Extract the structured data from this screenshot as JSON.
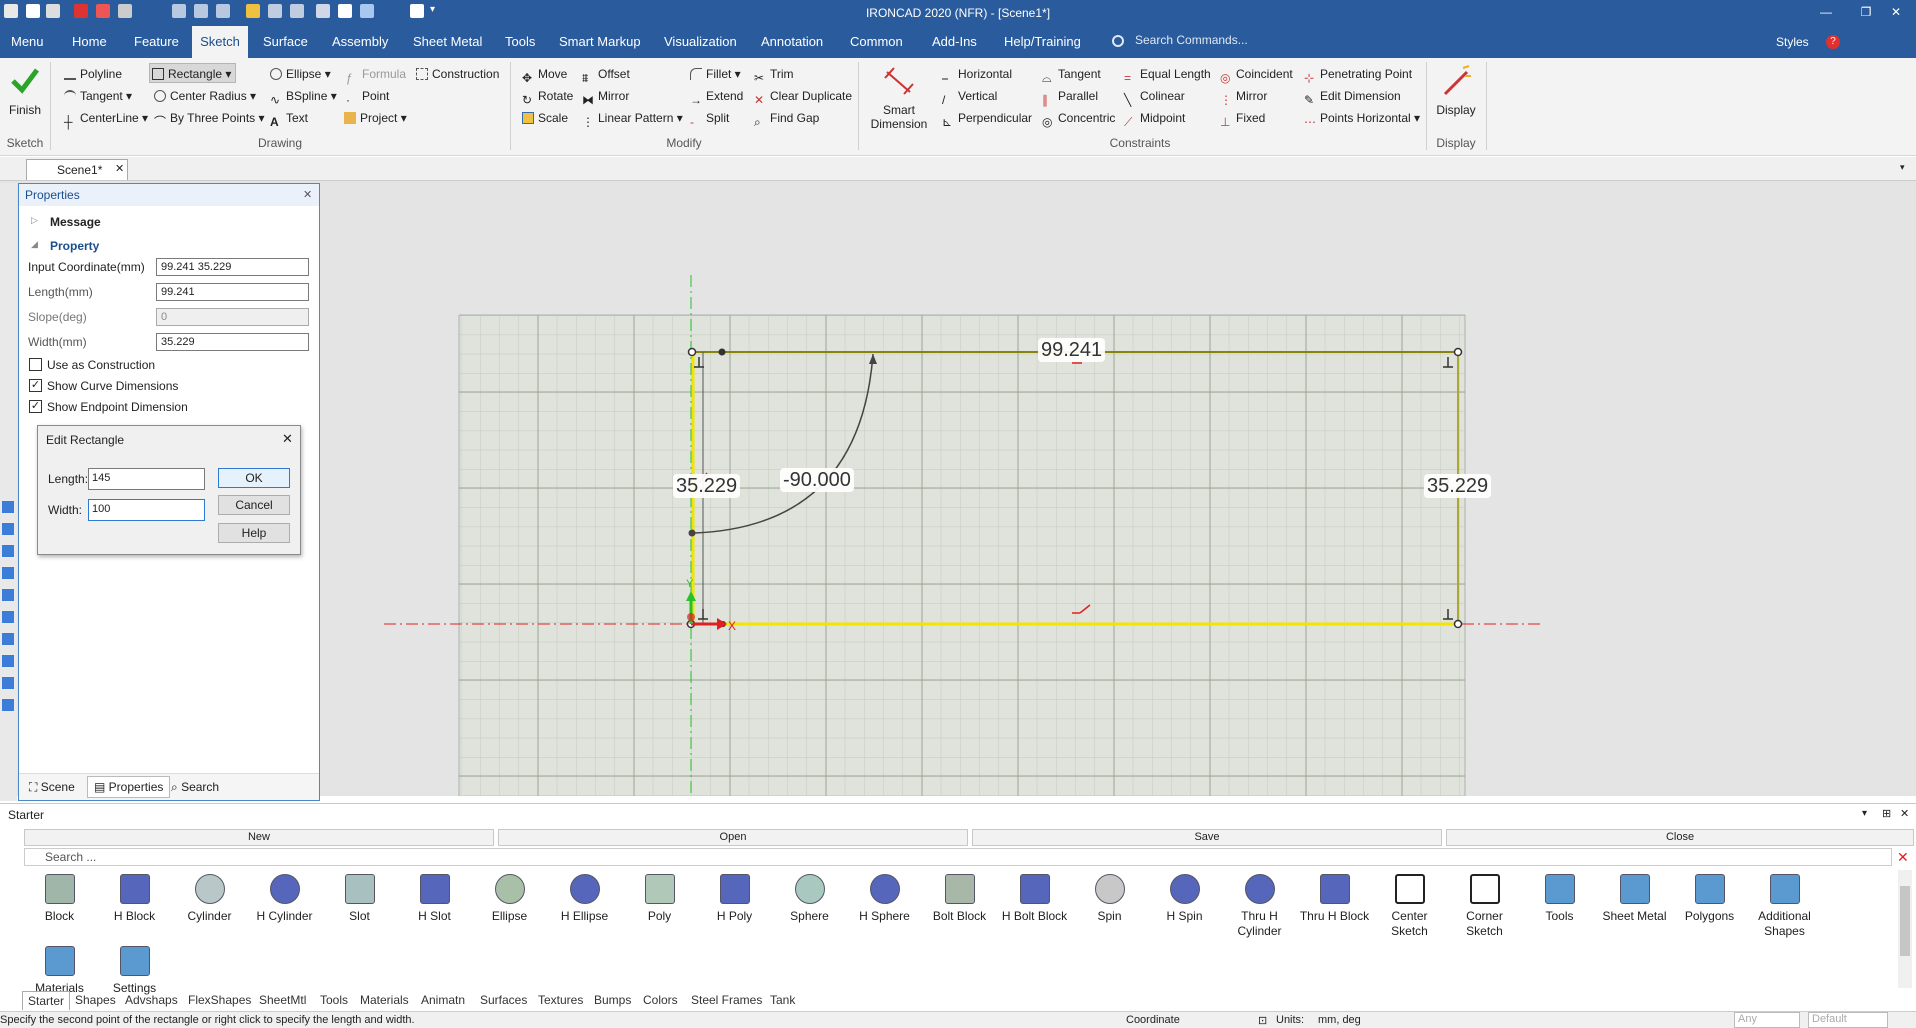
{
  "window": {
    "title": "IRONCAD 2020 (NFR) - [Scene1*]"
  },
  "menu": {
    "items": [
      "Menu",
      "Home",
      "Feature",
      "Sketch",
      "Surface",
      "Assembly",
      "Sheet Metal",
      "Tools",
      "Smart Markup",
      "Visualization",
      "Annotation",
      "Common",
      "Add-Ins",
      "Help/Training"
    ],
    "active": "Sketch",
    "search_placeholder": "Search Commands...",
    "styles": "Styles"
  },
  "ribbon": {
    "finish": "Finish",
    "drawing": {
      "polyline": "Polyline",
      "rectangle": "Rectangle",
      "ellipse": "Ellipse",
      "formula": "Formula",
      "construction": "Construction",
      "tangent": "Tangent",
      "center_radius": "Center Radius",
      "bspline": "BSpline",
      "point": "Point",
      "centerline": "CenterLine",
      "by_three_points": "By Three Points",
      "text": "Text",
      "project": "Project"
    },
    "modify": {
      "move": "Move",
      "offset": "Offset",
      "fillet": "Fillet",
      "trim": "Trim",
      "rotate": "Rotate",
      "mirror": "Mirror",
      "extend": "Extend",
      "clear_duplicate": "Clear Duplicate",
      "scale": "Scale",
      "linear_pattern": "Linear Pattern",
      "split": "Split",
      "find_gap": "Find Gap"
    },
    "smart_dimension": "Smart Dimension",
    "constraints": {
      "horizontal": "Horizontal",
      "tangent": "Tangent",
      "equal_length": "Equal Length",
      "coincident": "Coincident",
      "penetrating_point": "Penetrating Point",
      "vertical": "Vertical",
      "parallel": "Parallel",
      "colinear": "Colinear",
      "mirror": "Mirror",
      "edit_dimension": "Edit Dimension",
      "perpendicular": "Perpendicular",
      "concentric": "Concentric",
      "midpoint": "Midpoint",
      "fixed": "Fixed",
      "points_horizontal": "Points Horizontal"
    },
    "display": "Display",
    "groups": {
      "sketch": "Sketch",
      "drawing": "Drawing",
      "modify": "Modify",
      "constraints": "Constraints",
      "display": "Display"
    }
  },
  "doc_tab": "Scene1*",
  "properties": {
    "title": "Properties",
    "message": "Message",
    "property": "Property",
    "rows": [
      {
        "label": "Input Coordinate(mm)",
        "value": "99.241 35.229"
      },
      {
        "label": "Length(mm)",
        "value": "99.241"
      },
      {
        "label": "Slope(deg)",
        "value": "0"
      },
      {
        "label": "Width(mm)",
        "value": "35.229"
      }
    ],
    "checks": [
      {
        "label": "Use as Construction",
        "checked": false
      },
      {
        "label": "Show Curve Dimensions",
        "checked": true
      },
      {
        "label": "Show Endpoint Dimension",
        "checked": true
      }
    ],
    "tabs": [
      "Scene",
      "Properties",
      "Search"
    ]
  },
  "dialog": {
    "title": "Edit Rectangle",
    "length_label": "Length:",
    "length_value": "145",
    "width_label": "Width:",
    "width_value": "100",
    "ok": "OK",
    "cancel": "Cancel",
    "help": "Help"
  },
  "dimensions": {
    "top": "99.241",
    "left": "35.229",
    "right": "35.229",
    "angle": "-90.000"
  },
  "starter": {
    "title": "Starter",
    "bars": [
      "New",
      "Open",
      "Save",
      "Close"
    ],
    "search_placeholder": "Search ...",
    "items": [
      "Block",
      "H Block",
      "Cylinder",
      "H Cylinder",
      "Slot",
      "H Slot",
      "Ellipse",
      "H Ellipse",
      "Poly",
      "H Poly",
      "Sphere",
      "H Sphere",
      "Bolt Block",
      "H Bolt Block",
      "Spin",
      "H Spin",
      "Thru H Cylinder",
      "Thru H Block",
      "Center Sketch",
      "Corner Sketch",
      "Tools",
      "Sheet Metal",
      "Polygons",
      "Additional Shapes",
      "Materials",
      "Settings"
    ],
    "tabs": [
      "Starter",
      "Shapes",
      "Advshaps",
      "FlexShapes",
      "SheetMtl",
      "Tools",
      "Materials",
      "Animatn",
      "Surfaces",
      "Textures",
      "Bumps",
      "Colors",
      "Steel Frames",
      "Tank"
    ]
  },
  "status": {
    "message": "Specify the second point of the rectangle or right click to specify the length and width.",
    "coordinate": "Coordinate",
    "units_label": "Units:",
    "units": "mm, deg",
    "any": "Any",
    "default": "Default"
  },
  "colors": {
    "title_bg": "#2a5b9d",
    "accent": "#1a4e8e",
    "sketch_yellow": "#f2e600",
    "axis_red": "#e02020",
    "axis_green": "#27c227"
  }
}
